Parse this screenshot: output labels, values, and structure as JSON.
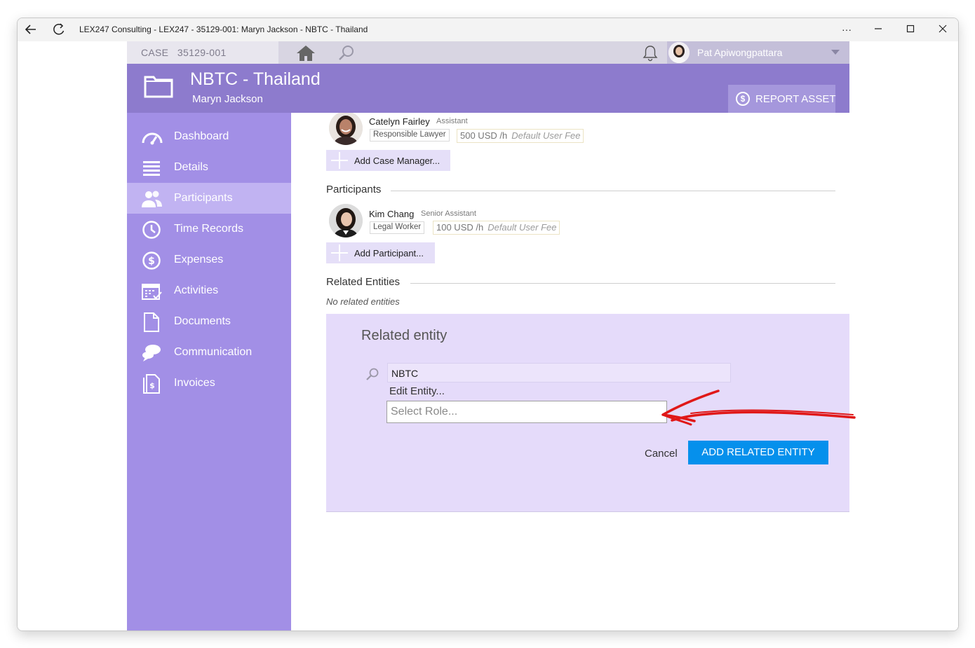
{
  "window": {
    "title": "LEX247 Consulting - LEX247 - 35129-001: Maryn Jackson - NBTC - Thailand",
    "more_icon": "more-horizontal-icon",
    "minimize_icon": "minimize-icon",
    "maximize_icon": "maximize-icon",
    "close_icon": "close-icon"
  },
  "topbar": {
    "case_label": "CASE   35129-001",
    "user_name": "Pat Apiwongpattara"
  },
  "header": {
    "title": "NBTC - Thailand",
    "client": "Maryn Jackson",
    "report_button": "REPORT ASSET"
  },
  "sidebar": {
    "items": [
      {
        "label": "Dashboard",
        "icon": "gauge-icon"
      },
      {
        "label": "Details",
        "icon": "list-icon"
      },
      {
        "label": "Participants",
        "icon": "people-icon"
      },
      {
        "label": "Time Records",
        "icon": "clock-icon"
      },
      {
        "label": "Expenses",
        "icon": "dollar-icon"
      },
      {
        "label": "Activities",
        "icon": "calendar-icon"
      },
      {
        "label": "Documents",
        "icon": "document-icon"
      },
      {
        "label": "Communication",
        "icon": "chat-icon"
      },
      {
        "label": "Invoices",
        "icon": "invoice-icon"
      }
    ],
    "active_index": 2
  },
  "case_managers": {
    "person": {
      "name": "Catelyn Fairley",
      "title": "Assistant",
      "role": "Responsible Lawyer",
      "fee": "500 USD /h",
      "fee_note": "Default User Fee"
    },
    "add_button": "Add Case Manager..."
  },
  "participants": {
    "heading": "Participants",
    "person": {
      "name": "Kim Chang",
      "title": "Senior Assistant",
      "role": "Legal Worker",
      "fee": "100 USD /h",
      "fee_note": "Default User Fee"
    },
    "add_button": "Add Participant..."
  },
  "related_entities": {
    "heading": "Related Entities",
    "empty_text": "No related entities"
  },
  "related_entity_form": {
    "title": "Related entity",
    "entity_value": "NBTC",
    "edit_link": "Edit Entity...",
    "role_placeholder": "Select Role...",
    "cancel_label": "Cancel",
    "submit_label": "ADD RELATED ENTITY"
  },
  "colors": {
    "header": "#8d7bcd",
    "sidebar": "#a28fe6",
    "sidebar_active": "#c1b3f2",
    "panel": "#e5dbfa",
    "primary_button": "#0590ec",
    "annotation_arrow": "#e01818"
  }
}
